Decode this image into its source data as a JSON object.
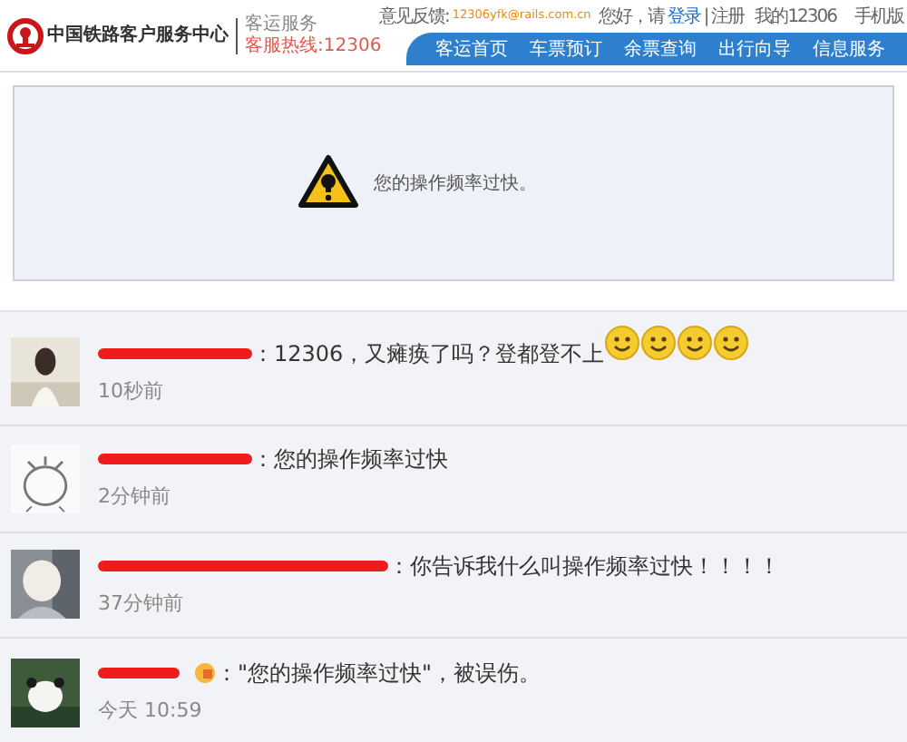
{
  "header": {
    "site_name": "中国铁路客户服务中心",
    "section": "客运服务",
    "hotline": "客服热线:12306",
    "feedback_label": "意见反馈:",
    "feedback_email": "12306yfk@rails.com.cn",
    "greeting": "您好，请",
    "login": "登录",
    "separator": "|",
    "register": "注册",
    "account": "我的12306",
    "mobile": "手机版",
    "nav": [
      "客运首页",
      "车票预订",
      "余票查询",
      "出行向导",
      "信息服务"
    ]
  },
  "notice": {
    "message": "您的操作频率过快。"
  },
  "comments": [
    {
      "text": "：12306，又瘫痪了吗？登都登不上",
      "time": "10秒前",
      "emoticons": [
        {
          "kind": "grin"
        },
        {
          "kind": "grin"
        },
        {
          "kind": "grin"
        },
        {
          "kind": "grin"
        }
      ],
      "name_badge": false
    },
    {
      "text": "：您的操作频率过快",
      "time": "2分钟前",
      "name_badge": false
    },
    {
      "text": "：你告诉我什么叫操作频率过快！！！！",
      "time": "37分钟前",
      "name_badge": false
    },
    {
      "text": "：\"您的操作频率过快\"，被误伤。",
      "time": "今天 10:59",
      "name_badge": true
    }
  ]
}
